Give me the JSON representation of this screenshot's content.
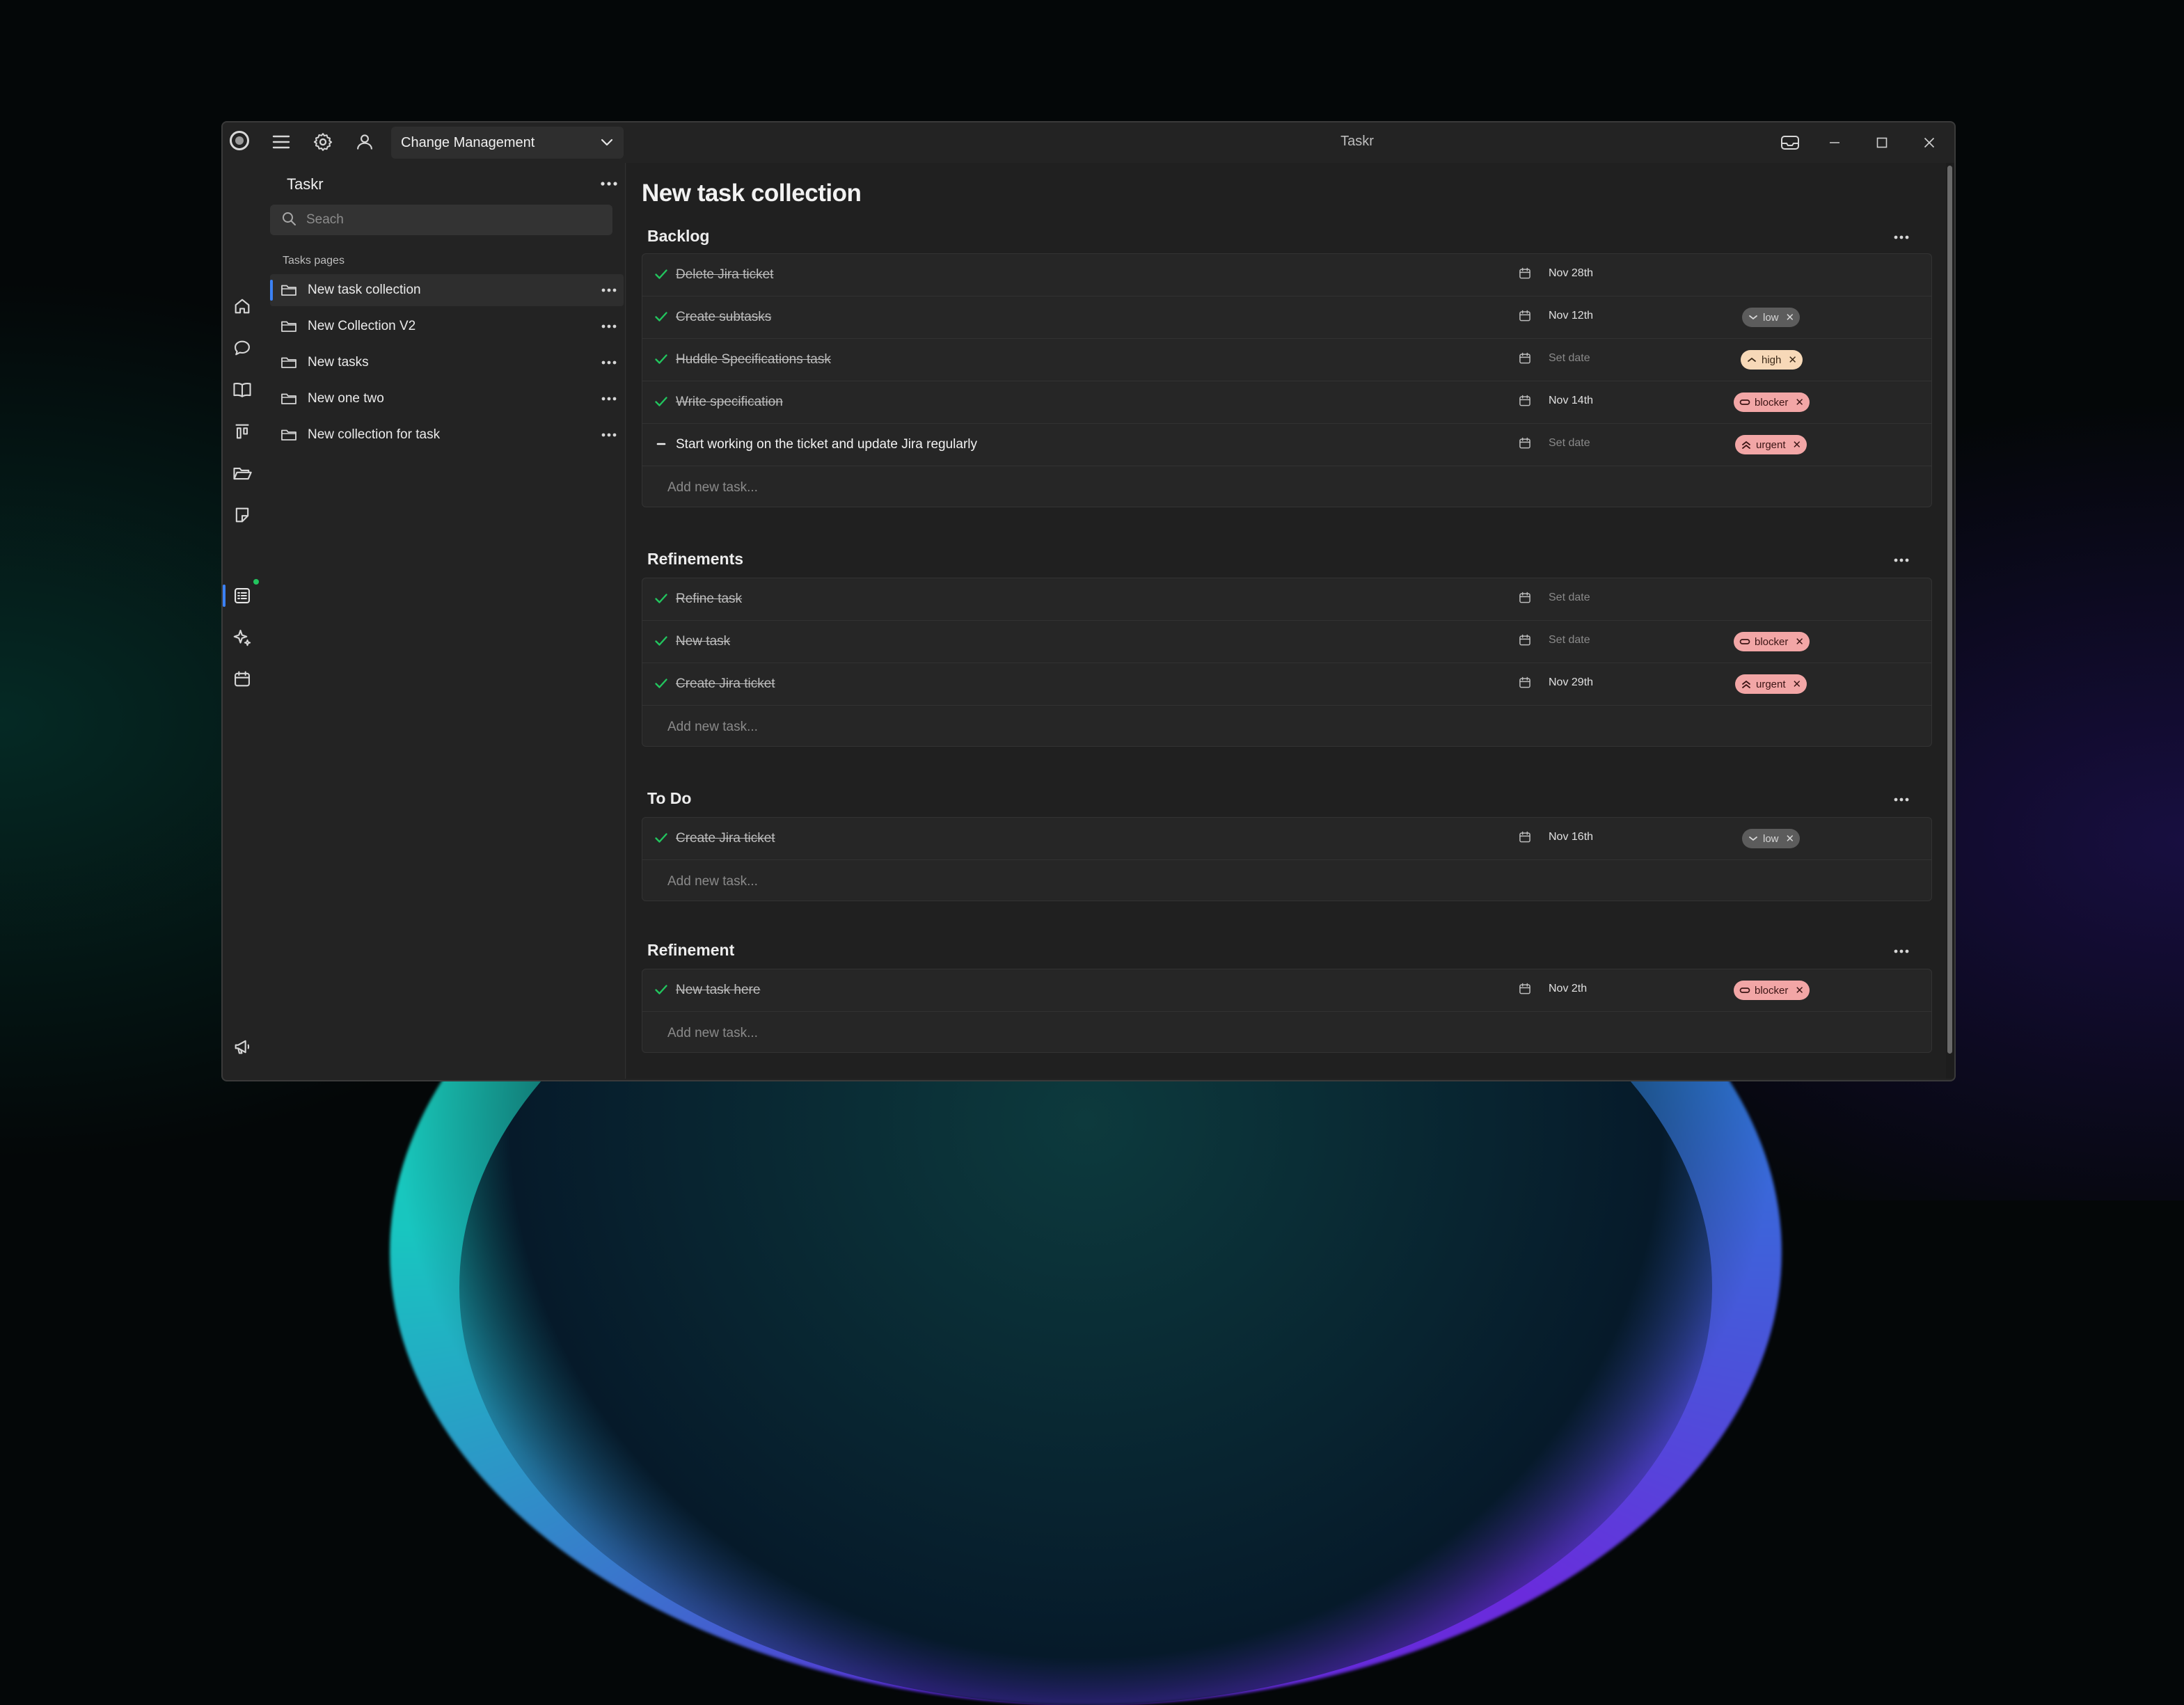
{
  "app": {
    "window_title": "Taskr",
    "workspace": "Change Management"
  },
  "sidebar": {
    "title": "Taskr",
    "search_placeholder": "Seach",
    "section_label": "Tasks pages",
    "pages": [
      {
        "label": "New task collection",
        "active": true
      },
      {
        "label": "New Collection V2",
        "active": false
      },
      {
        "label": "New tasks",
        "active": false
      },
      {
        "label": "New one two",
        "active": false
      },
      {
        "label": "New collection for task",
        "active": false
      }
    ]
  },
  "main": {
    "title": "New task collection",
    "add_task_placeholder": "Add new task...",
    "sections": [
      {
        "name": "Backlog",
        "tasks": [
          {
            "name": "Delete Jira ticket",
            "done": true,
            "date": "Nov 28th",
            "tag": null
          },
          {
            "name": "Create subtasks",
            "done": true,
            "date": "Nov 12th",
            "tag": "low"
          },
          {
            "name": "Huddle Specifications task",
            "done": true,
            "date": "Set date",
            "tag": "high"
          },
          {
            "name": "Write specification",
            "done": true,
            "date": "Nov 14th",
            "tag": "blocker"
          },
          {
            "name": "Start working on the ticket and update Jira regularly",
            "done": false,
            "date": "Set date",
            "tag": "urgent"
          }
        ]
      },
      {
        "name": "Refinements",
        "tasks": [
          {
            "name": "Refine task",
            "done": true,
            "date": "Set date",
            "tag": null
          },
          {
            "name": "New task",
            "done": true,
            "date": "Set date",
            "tag": "blocker"
          },
          {
            "name": "Create Jira ticket",
            "done": true,
            "date": "Nov 29th",
            "tag": "urgent"
          }
        ]
      },
      {
        "name": "To Do",
        "tasks": [
          {
            "name": "Create Jira ticket",
            "done": true,
            "date": "Nov 16th",
            "tag": "low"
          }
        ]
      },
      {
        "name": "Refinement",
        "tasks": [
          {
            "name": "New task here",
            "done": true,
            "date": "Nov 2th",
            "tag": "blocker"
          }
        ]
      }
    ]
  },
  "tag_colors": {
    "low": "#5c5c5c",
    "high": "#f7d9b8",
    "blocker": "#f2a6a6",
    "urgent": "#f2a6a6"
  },
  "icons": {
    "titlebar": [
      "app-logo-icon",
      "hamburger-menu-icon",
      "gear-icon",
      "user-icon",
      "chevron-down-icon",
      "inbox-icon",
      "minimize-icon",
      "maximize-icon",
      "close-icon"
    ],
    "rail": [
      "home-icon",
      "chat-icon",
      "book-icon",
      "board-icon",
      "folder-open-icon",
      "sticky-note-icon",
      "tasks-list-icon",
      "sparkles-icon",
      "calendar-icon",
      "megaphone-icon",
      "sidebar-toggle-icon"
    ]
  }
}
